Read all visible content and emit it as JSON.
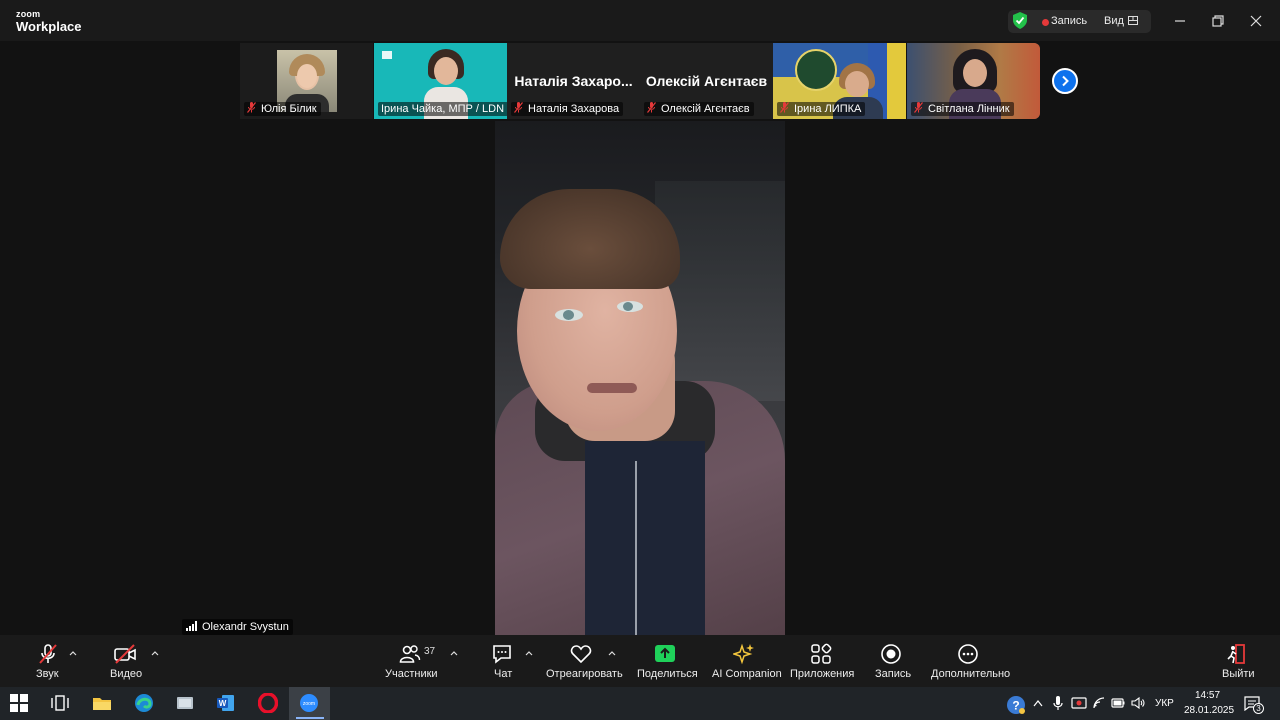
{
  "titlebar": {
    "brand_top": "zoom",
    "brand_bottom": "Workplace",
    "record_label": "Запись",
    "view_label": "Вид"
  },
  "thumbnails": [
    {
      "name": "Юлія Білик",
      "type": "video",
      "muted": true
    },
    {
      "name": "Ірина Чайка, МПР / LDN",
      "type": "video",
      "muted": false
    },
    {
      "name": "Наталія Захарова",
      "display": "Наталія Захаро...",
      "type": "name",
      "muted": true
    },
    {
      "name": "Олексій Агєнтаєв",
      "display": "Олексій Агєнтаєв",
      "type": "name",
      "muted": true
    },
    {
      "name": "Ірина ЛИПКА",
      "type": "video",
      "muted": true
    },
    {
      "name": "Світлана Лінник",
      "type": "video",
      "muted": true
    }
  ],
  "speaker": {
    "name": "Olexandr Svystun"
  },
  "controls": {
    "audio": "Звук",
    "video": "Видео",
    "participants": "Участники",
    "participants_count": "37",
    "chat": "Чат",
    "react": "Отреагировать",
    "share": "Поделиться",
    "ai": "AI Companion",
    "apps": "Приложения",
    "record": "Запись",
    "more": "Дополнительно",
    "leave": "Выйти"
  },
  "taskbar": {
    "lang": "УКР",
    "time": "14:57",
    "date": "28.01.2025",
    "notifications": "3"
  },
  "colors": {
    "accent": "#0e72ed",
    "share_green": "#1fd15a",
    "mute_red": "#e5393a",
    "shield_green": "#23c14a"
  }
}
